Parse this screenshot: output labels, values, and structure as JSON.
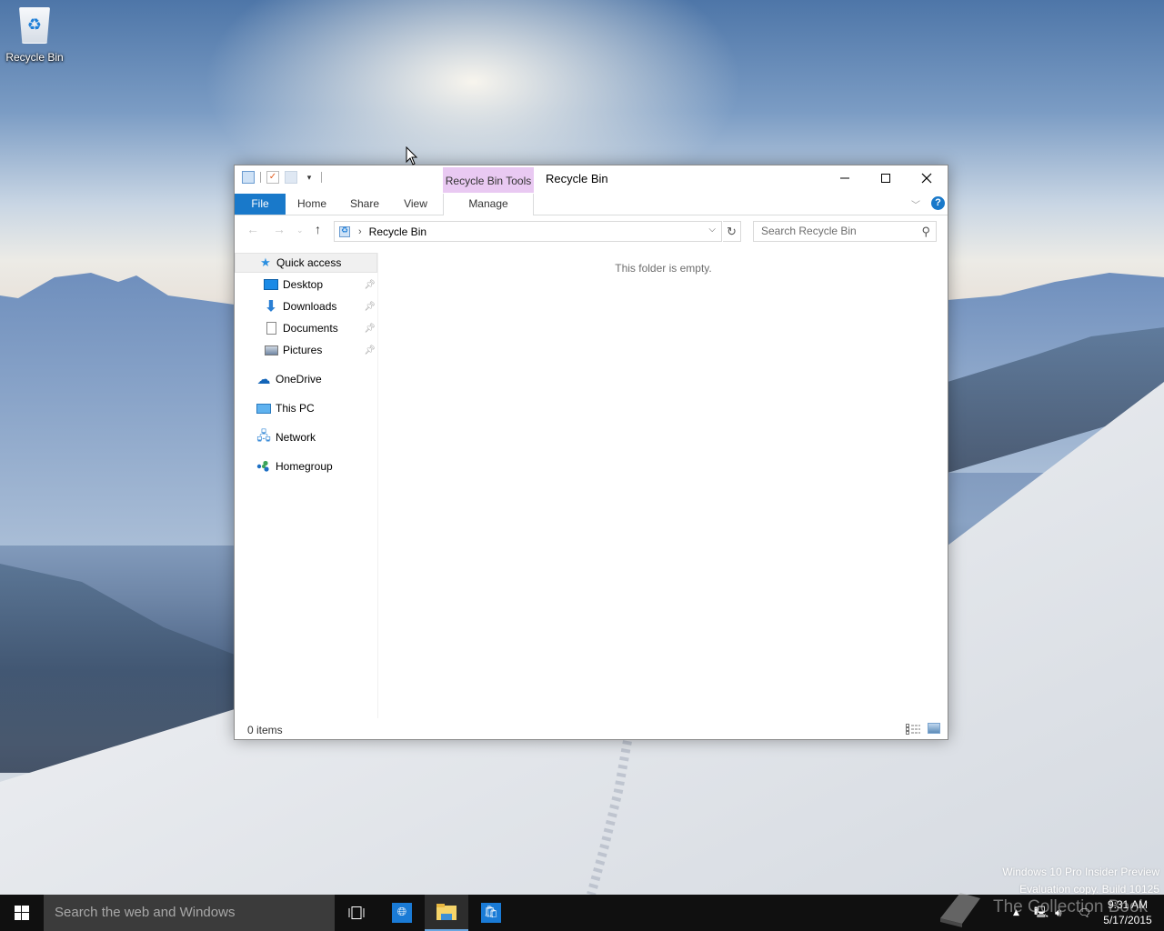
{
  "desktop": {
    "icons": [
      {
        "label": "Recycle Bin",
        "icon": "recycle-bin-icon"
      }
    ],
    "watermark": {
      "line1": "Windows 10 Pro Insider Preview",
      "line2": "Evaluation copy. Build 10125"
    },
    "overlay_brand": "The Collection Book"
  },
  "explorer": {
    "title": "Recycle Bin",
    "contextual_tab_group": "Recycle Bin Tools",
    "quick_access_toolbar": [
      "properties-icon",
      "new-folder-icon",
      "customize-dropdown-icon"
    ],
    "ribbon_tabs": [
      {
        "label": "File",
        "active": true
      },
      {
        "label": "Home"
      },
      {
        "label": "Share"
      },
      {
        "label": "View"
      },
      {
        "label": "Manage"
      }
    ],
    "window_buttons": {
      "minimize": "─",
      "maximize": "☐",
      "close": "✕"
    },
    "help_label": "?",
    "navigation": {
      "back": "←",
      "forward": "→",
      "recent": "⌄",
      "up": "↑"
    },
    "address": {
      "separator": "›",
      "path": "Recycle Bin"
    },
    "search": {
      "placeholder": "Search Recycle Bin"
    },
    "nav_pane": {
      "items": [
        {
          "label": "Quick access",
          "icon": "star-icon",
          "selected": true
        },
        {
          "label": "Desktop",
          "icon": "desktop-icon",
          "pinned": true
        },
        {
          "label": "Downloads",
          "icon": "downloads-icon",
          "pinned": true
        },
        {
          "label": "Documents",
          "icon": "documents-icon",
          "pinned": true
        },
        {
          "label": "Pictures",
          "icon": "pictures-icon",
          "pinned": true
        },
        {
          "label": "OneDrive",
          "icon": "onedrive-icon"
        },
        {
          "label": "This PC",
          "icon": "this-pc-icon"
        },
        {
          "label": "Network",
          "icon": "network-icon"
        },
        {
          "label": "Homegroup",
          "icon": "homegroup-icon"
        }
      ]
    },
    "content": {
      "empty_message": "This folder is empty."
    },
    "status": {
      "item_count": "0 items"
    }
  },
  "taskbar": {
    "search_placeholder": "Search the web and Windows",
    "apps": [
      {
        "name": "task-view",
        "icon": "task-view-icon"
      },
      {
        "name": "edge",
        "icon": "globe-icon"
      },
      {
        "name": "file-explorer",
        "icon": "folder-icon",
        "active": true
      },
      {
        "name": "store",
        "icon": "store-icon"
      }
    ],
    "clock": {
      "time": "9:31 AM",
      "date": "5/17/2015"
    }
  },
  "colors": {
    "ribbon_file_tab": "#1979ca",
    "contextual_tab": "#e9c9f2",
    "taskbar": "#101010",
    "taskbar_search": "#3b3b3b",
    "accent": "#1a7bd6"
  }
}
